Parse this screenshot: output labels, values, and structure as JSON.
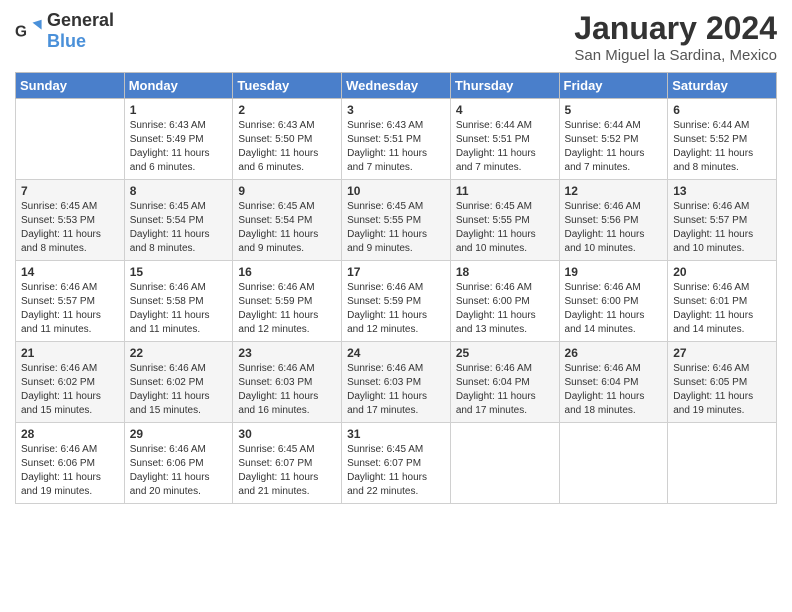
{
  "header": {
    "logo": {
      "general": "General",
      "blue": "Blue"
    },
    "title": "January 2024",
    "location": "San Miguel la Sardina, Mexico"
  },
  "days_of_week": [
    "Sunday",
    "Monday",
    "Tuesday",
    "Wednesday",
    "Thursday",
    "Friday",
    "Saturday"
  ],
  "weeks": [
    [
      {
        "day": "",
        "sunrise": "",
        "sunset": "",
        "daylight": ""
      },
      {
        "day": "1",
        "sunrise": "Sunrise: 6:43 AM",
        "sunset": "Sunset: 5:49 PM",
        "daylight": "Daylight: 11 hours and 6 minutes."
      },
      {
        "day": "2",
        "sunrise": "Sunrise: 6:43 AM",
        "sunset": "Sunset: 5:50 PM",
        "daylight": "Daylight: 11 hours and 6 minutes."
      },
      {
        "day": "3",
        "sunrise": "Sunrise: 6:43 AM",
        "sunset": "Sunset: 5:51 PM",
        "daylight": "Daylight: 11 hours and 7 minutes."
      },
      {
        "day": "4",
        "sunrise": "Sunrise: 6:44 AM",
        "sunset": "Sunset: 5:51 PM",
        "daylight": "Daylight: 11 hours and 7 minutes."
      },
      {
        "day": "5",
        "sunrise": "Sunrise: 6:44 AM",
        "sunset": "Sunset: 5:52 PM",
        "daylight": "Daylight: 11 hours and 7 minutes."
      },
      {
        "day": "6",
        "sunrise": "Sunrise: 6:44 AM",
        "sunset": "Sunset: 5:52 PM",
        "daylight": "Daylight: 11 hours and 8 minutes."
      }
    ],
    [
      {
        "day": "7",
        "sunrise": "Sunrise: 6:45 AM",
        "sunset": "Sunset: 5:53 PM",
        "daylight": "Daylight: 11 hours and 8 minutes."
      },
      {
        "day": "8",
        "sunrise": "Sunrise: 6:45 AM",
        "sunset": "Sunset: 5:54 PM",
        "daylight": "Daylight: 11 hours and 8 minutes."
      },
      {
        "day": "9",
        "sunrise": "Sunrise: 6:45 AM",
        "sunset": "Sunset: 5:54 PM",
        "daylight": "Daylight: 11 hours and 9 minutes."
      },
      {
        "day": "10",
        "sunrise": "Sunrise: 6:45 AM",
        "sunset": "Sunset: 5:55 PM",
        "daylight": "Daylight: 11 hours and 9 minutes."
      },
      {
        "day": "11",
        "sunrise": "Sunrise: 6:45 AM",
        "sunset": "Sunset: 5:55 PM",
        "daylight": "Daylight: 11 hours and 10 minutes."
      },
      {
        "day": "12",
        "sunrise": "Sunrise: 6:46 AM",
        "sunset": "Sunset: 5:56 PM",
        "daylight": "Daylight: 11 hours and 10 minutes."
      },
      {
        "day": "13",
        "sunrise": "Sunrise: 6:46 AM",
        "sunset": "Sunset: 5:57 PM",
        "daylight": "Daylight: 11 hours and 10 minutes."
      }
    ],
    [
      {
        "day": "14",
        "sunrise": "Sunrise: 6:46 AM",
        "sunset": "Sunset: 5:57 PM",
        "daylight": "Daylight: 11 hours and 11 minutes."
      },
      {
        "day": "15",
        "sunrise": "Sunrise: 6:46 AM",
        "sunset": "Sunset: 5:58 PM",
        "daylight": "Daylight: 11 hours and 11 minutes."
      },
      {
        "day": "16",
        "sunrise": "Sunrise: 6:46 AM",
        "sunset": "Sunset: 5:59 PM",
        "daylight": "Daylight: 11 hours and 12 minutes."
      },
      {
        "day": "17",
        "sunrise": "Sunrise: 6:46 AM",
        "sunset": "Sunset: 5:59 PM",
        "daylight": "Daylight: 11 hours and 12 minutes."
      },
      {
        "day": "18",
        "sunrise": "Sunrise: 6:46 AM",
        "sunset": "Sunset: 6:00 PM",
        "daylight": "Daylight: 11 hours and 13 minutes."
      },
      {
        "day": "19",
        "sunrise": "Sunrise: 6:46 AM",
        "sunset": "Sunset: 6:00 PM",
        "daylight": "Daylight: 11 hours and 14 minutes."
      },
      {
        "day": "20",
        "sunrise": "Sunrise: 6:46 AM",
        "sunset": "Sunset: 6:01 PM",
        "daylight": "Daylight: 11 hours and 14 minutes."
      }
    ],
    [
      {
        "day": "21",
        "sunrise": "Sunrise: 6:46 AM",
        "sunset": "Sunset: 6:02 PM",
        "daylight": "Daylight: 11 hours and 15 minutes."
      },
      {
        "day": "22",
        "sunrise": "Sunrise: 6:46 AM",
        "sunset": "Sunset: 6:02 PM",
        "daylight": "Daylight: 11 hours and 15 minutes."
      },
      {
        "day": "23",
        "sunrise": "Sunrise: 6:46 AM",
        "sunset": "Sunset: 6:03 PM",
        "daylight": "Daylight: 11 hours and 16 minutes."
      },
      {
        "day": "24",
        "sunrise": "Sunrise: 6:46 AM",
        "sunset": "Sunset: 6:03 PM",
        "daylight": "Daylight: 11 hours and 17 minutes."
      },
      {
        "day": "25",
        "sunrise": "Sunrise: 6:46 AM",
        "sunset": "Sunset: 6:04 PM",
        "daylight": "Daylight: 11 hours and 17 minutes."
      },
      {
        "day": "26",
        "sunrise": "Sunrise: 6:46 AM",
        "sunset": "Sunset: 6:04 PM",
        "daylight": "Daylight: 11 hours and 18 minutes."
      },
      {
        "day": "27",
        "sunrise": "Sunrise: 6:46 AM",
        "sunset": "Sunset: 6:05 PM",
        "daylight": "Daylight: 11 hours and 19 minutes."
      }
    ],
    [
      {
        "day": "28",
        "sunrise": "Sunrise: 6:46 AM",
        "sunset": "Sunset: 6:06 PM",
        "daylight": "Daylight: 11 hours and 19 minutes."
      },
      {
        "day": "29",
        "sunrise": "Sunrise: 6:46 AM",
        "sunset": "Sunset: 6:06 PM",
        "daylight": "Daylight: 11 hours and 20 minutes."
      },
      {
        "day": "30",
        "sunrise": "Sunrise: 6:45 AM",
        "sunset": "Sunset: 6:07 PM",
        "daylight": "Daylight: 11 hours and 21 minutes."
      },
      {
        "day": "31",
        "sunrise": "Sunrise: 6:45 AM",
        "sunset": "Sunset: 6:07 PM",
        "daylight": "Daylight: 11 hours and 22 minutes."
      },
      {
        "day": "",
        "sunrise": "",
        "sunset": "",
        "daylight": ""
      },
      {
        "day": "",
        "sunrise": "",
        "sunset": "",
        "daylight": ""
      },
      {
        "day": "",
        "sunrise": "",
        "sunset": "",
        "daylight": ""
      }
    ]
  ]
}
